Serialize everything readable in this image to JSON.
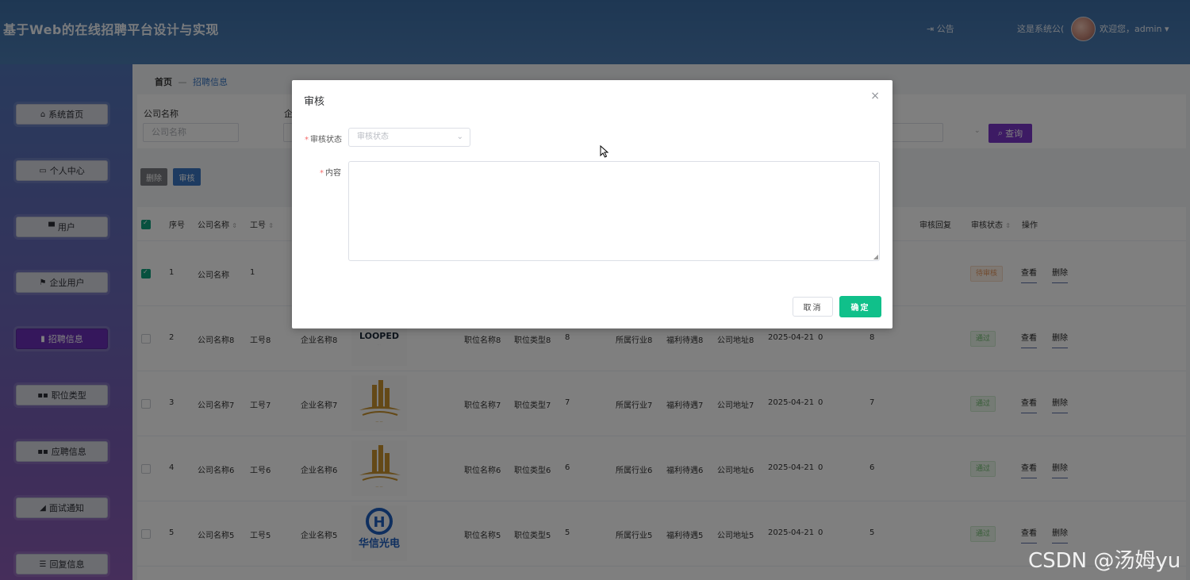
{
  "header": {
    "title": "基于Web的在线招聘平台设计与实现",
    "notice": "⇥ 公告",
    "system_msg": "这是系统公(",
    "welcome": "欢迎您，admin ▾"
  },
  "sidebar": {
    "items": [
      {
        "label": "系统首页",
        "icon": "⌂"
      },
      {
        "label": "个人中心",
        "icon": "▭"
      },
      {
        "label": "用户",
        "icon": "▀"
      },
      {
        "label": "企业用户",
        "icon": "⚑"
      },
      {
        "label": "招聘信息",
        "icon": "▮"
      },
      {
        "label": "职位类型",
        "icon": "▪▪"
      },
      {
        "label": "应聘信息",
        "icon": "▪▪"
      },
      {
        "label": "面试通知",
        "icon": "◢"
      },
      {
        "label": "回复信息",
        "icon": "☰"
      }
    ]
  },
  "breadcrumb": {
    "home": "首页",
    "sep": "—",
    "current": "招聘信息"
  },
  "search": {
    "company_label": "公司名称",
    "company_placeholder": "公司名称",
    "enterprise_label": "企",
    "query_label": "查询"
  },
  "toolbar": {
    "delete_label": "删除",
    "audit_label": "审核"
  },
  "table": {
    "headers": {
      "index": "序号",
      "company": "公司名称",
      "job_no": "工号",
      "audit_reply": "审核回复",
      "audit_status": "审核状态",
      "operation": "操作"
    },
    "rows": [
      {
        "index": "1",
        "company": "公司名称",
        "job_no": "1",
        "enterprise": "",
        "position": "",
        "type": "",
        "num": "",
        "industry": "",
        "welfare": "",
        "address": "",
        "date": "",
        "zero": "",
        "count": "",
        "status": "待审核",
        "checked": true
      },
      {
        "index": "2",
        "company": "公司名称8",
        "job_no": "工号8",
        "enterprise": "企业名称8",
        "position": "职位名称8",
        "type": "职位类型8",
        "num": "8",
        "industry": "所属行业8",
        "welfare": "福利待遇8",
        "address": "公司地址8",
        "date": "2025-04-21",
        "zero": "0",
        "count": "8",
        "status": "通过",
        "checked": false
      },
      {
        "index": "3",
        "company": "公司名称7",
        "job_no": "工号7",
        "enterprise": "企业名称7",
        "position": "职位名称7",
        "type": "职位类型7",
        "num": "7",
        "industry": "所属行业7",
        "welfare": "福利待遇7",
        "address": "公司地址7",
        "date": "2025-04-21",
        "zero": "0",
        "count": "7",
        "status": "通过",
        "checked": false
      },
      {
        "index": "4",
        "company": "公司名称6",
        "job_no": "工号6",
        "enterprise": "企业名称6",
        "position": "职位名称6",
        "type": "职位类型6",
        "num": "6",
        "industry": "所属行业6",
        "welfare": "福利待遇6",
        "address": "公司地址6",
        "date": "2025-04-21",
        "zero": "0",
        "count": "6",
        "status": "通过",
        "checked": false
      },
      {
        "index": "5",
        "company": "公司名称5",
        "job_no": "工号5",
        "enterprise": "企业名称5",
        "position": "职位名称5",
        "type": "职位类型5",
        "num": "5",
        "industry": "所属行业5",
        "welfare": "福利待遇5",
        "address": "公司地址5",
        "date": "2025-04-21",
        "zero": "0",
        "count": "5",
        "status": "通过",
        "checked": false
      }
    ],
    "view_label": "查看",
    "delete_label": "删除",
    "logos": {
      "looped": "LOOPED",
      "huaxin": "华信光电"
    }
  },
  "dialog": {
    "title": "审核",
    "close": "×",
    "status_label": "审核状态",
    "status_placeholder": "审核状态",
    "content_label": "内容",
    "cancel_label": "取消",
    "ok_label": "确定"
  },
  "watermark": "CSDN @汤姆yu",
  "colors": {
    "header": "#3d6fa7",
    "accent_purple": "#7a36c8",
    "active_menu": "#6a2fb8",
    "ok_green": "#10c08a",
    "audit_blue": "#3b77c2"
  }
}
